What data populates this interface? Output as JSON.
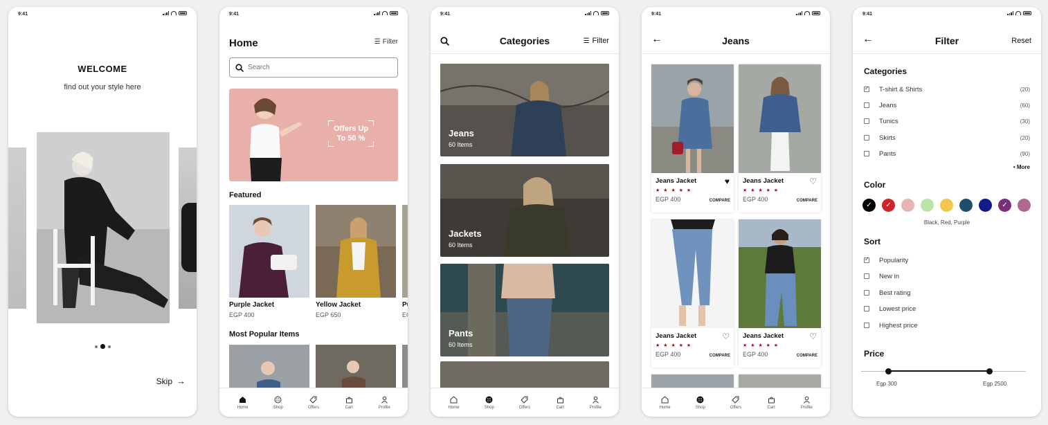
{
  "status": {
    "time": "9:41"
  },
  "welcome": {
    "title": "WELCOME",
    "subtitle": "find out your style here",
    "skip": "Skip"
  },
  "home": {
    "title": "Home",
    "filter": "Filter",
    "search_placeholder": "Search",
    "banner_text_1": "Offers Up",
    "banner_text_2": "To 50 %",
    "featured_title": "Featured",
    "featured": [
      {
        "name": "Purple Jacket",
        "price": "EGP 400"
      },
      {
        "name": "Yellow Jacket",
        "price": "EGP 650"
      },
      {
        "name": "Pu",
        "price": "EG"
      }
    ],
    "popular_title": "Most Popular Items"
  },
  "nav": [
    {
      "label": "Home",
      "icon": "home-icon"
    },
    {
      "label": "Shop",
      "icon": "shop-icon"
    },
    {
      "label": "Offers",
      "icon": "offers-icon"
    },
    {
      "label": "Cart",
      "icon": "cart-icon"
    },
    {
      "label": "Profile",
      "icon": "profile-icon"
    }
  ],
  "categories": {
    "title": "Categories",
    "filter": "Filter",
    "items": [
      {
        "label": "Jeans",
        "count": "60 Items"
      },
      {
        "label": "Jackets",
        "count": "60 Items"
      },
      {
        "label": "Pants",
        "count": "60 Items"
      }
    ]
  },
  "jeans": {
    "title": "Jeans",
    "products": [
      {
        "name": "Jeans Jacket",
        "stars": "★ ★ ★ ★ ★",
        "price": "EGP 400",
        "compare": "COMPARE",
        "liked": true
      },
      {
        "name": "Jeans Jacket",
        "stars": "★ ★ ★ ★ ★",
        "price": "EGP 400",
        "compare": "COMPARE",
        "liked": false
      },
      {
        "name": "Jeans Jacket",
        "stars": "★ ★ ★ ★ ★",
        "price": "EGP 400",
        "compare": "COMPARE",
        "liked": false
      },
      {
        "name": "Jeans Jacket",
        "stars": "★ ★ ★ ★ ★",
        "price": "EGP 400",
        "compare": "COMPARE",
        "liked": false
      }
    ]
  },
  "filter": {
    "title": "Filter",
    "reset": "Reset",
    "categories_title": "Categories",
    "categories": [
      {
        "label": "T-shirt & Shirts",
        "count": "(20)",
        "checked": true
      },
      {
        "label": "Jeans",
        "count": "(60)",
        "checked": false
      },
      {
        "label": "Tunics",
        "count": "(30)",
        "checked": false
      },
      {
        "label": "Skirts",
        "count": "(20)",
        "checked": false
      },
      {
        "label": "Pants",
        "count": "(90)",
        "checked": false
      }
    ],
    "more": "More",
    "color_title": "Color",
    "colors": [
      {
        "hex": "#000000",
        "selected": true
      },
      {
        "hex": "#d1232a",
        "selected": true
      },
      {
        "hex": "#e8b4b6",
        "selected": false
      },
      {
        "hex": "#b9e6a8",
        "selected": false
      },
      {
        "hex": "#f2c84b",
        "selected": false
      },
      {
        "hex": "#1f4e6b",
        "selected": false
      },
      {
        "hex": "#0f1b8a",
        "selected": false
      },
      {
        "hex": "#7a2e7a",
        "selected": true
      },
      {
        "hex": "#b06a90",
        "selected": false
      }
    ],
    "selected_colors": "Black, Red, Purple",
    "sort_title": "Sort",
    "sort": [
      {
        "label": "Popularity",
        "checked": true
      },
      {
        "label": "New in",
        "checked": false
      },
      {
        "label": "Best rating",
        "checked": false
      },
      {
        "label": "Lowest price",
        "checked": false
      },
      {
        "label": "Highest price",
        "checked": false
      }
    ],
    "price_title": "Price",
    "price_min": "Egp 300",
    "price_max": "Egp 2500"
  }
}
